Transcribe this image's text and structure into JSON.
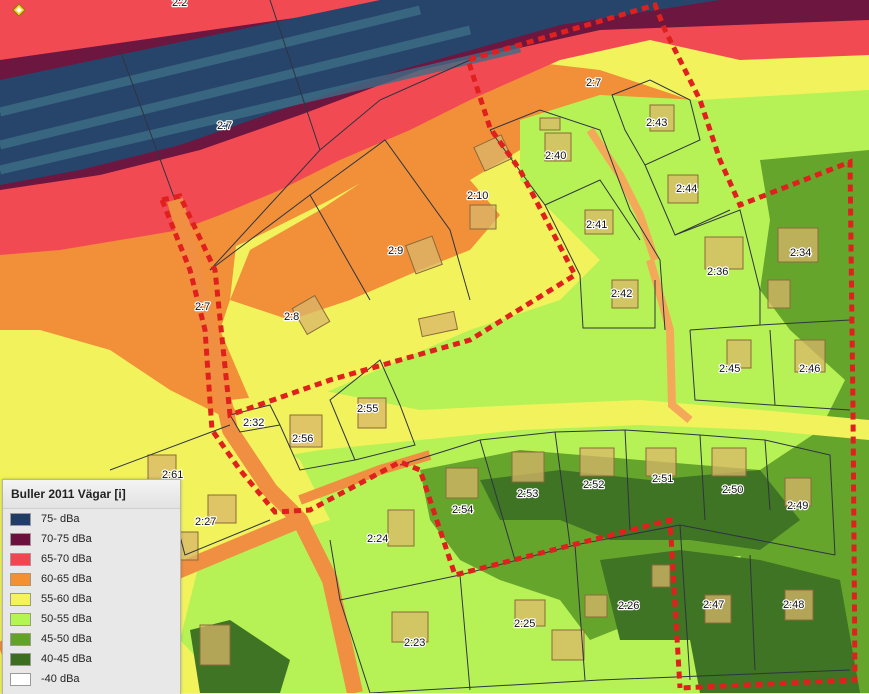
{
  "map": {
    "parcels": [
      {
        "label": "2:2"
      },
      {
        "label": "2:7"
      },
      {
        "label": "2:7"
      },
      {
        "label": "2:7"
      },
      {
        "label": "2:43"
      },
      {
        "label": "2:40"
      },
      {
        "label": "2:44"
      },
      {
        "label": "2:10"
      },
      {
        "label": "2:41"
      },
      {
        "label": "2:9"
      },
      {
        "label": "2:34"
      },
      {
        "label": "2:36"
      },
      {
        "label": "2:42"
      },
      {
        "label": "2:8"
      },
      {
        "label": "2:45"
      },
      {
        "label": "2:46"
      },
      {
        "label": "2:55"
      },
      {
        "label": "2:32"
      },
      {
        "label": "2:56"
      },
      {
        "label": "2:61"
      },
      {
        "label": "2:52"
      },
      {
        "label": "2:51"
      },
      {
        "label": "2:50"
      },
      {
        "label": "2:53"
      },
      {
        "label": "2:49"
      },
      {
        "label": "2:54"
      },
      {
        "label": "2:27"
      },
      {
        "label": "2:24"
      },
      {
        "label": "2:26"
      },
      {
        "label": "2:47"
      },
      {
        "label": "2:48"
      },
      {
        "label": "2:25"
      },
      {
        "label": "2:23"
      }
    ]
  },
  "legend": {
    "title": "Buller 2011 Vägar [i]",
    "items": [
      {
        "label": "75- dBa",
        "color": "#1f3b66"
      },
      {
        "label": "70-75 dBa",
        "color": "#6b0f3c"
      },
      {
        "label": "65-70 dBa",
        "color": "#f2464e"
      },
      {
        "label": "60-65 dBa",
        "color": "#f39031"
      },
      {
        "label": "55-60 dBa",
        "color": "#f4f45a"
      },
      {
        "label": "50-55 dBa",
        "color": "#b3f551"
      },
      {
        "label": "45-50 dBa",
        "color": "#62a229"
      },
      {
        "label": "40-45 dBa",
        "color": "#3c6e21"
      },
      {
        "label": "-40 dBa",
        "color": "#ffffff"
      }
    ]
  }
}
